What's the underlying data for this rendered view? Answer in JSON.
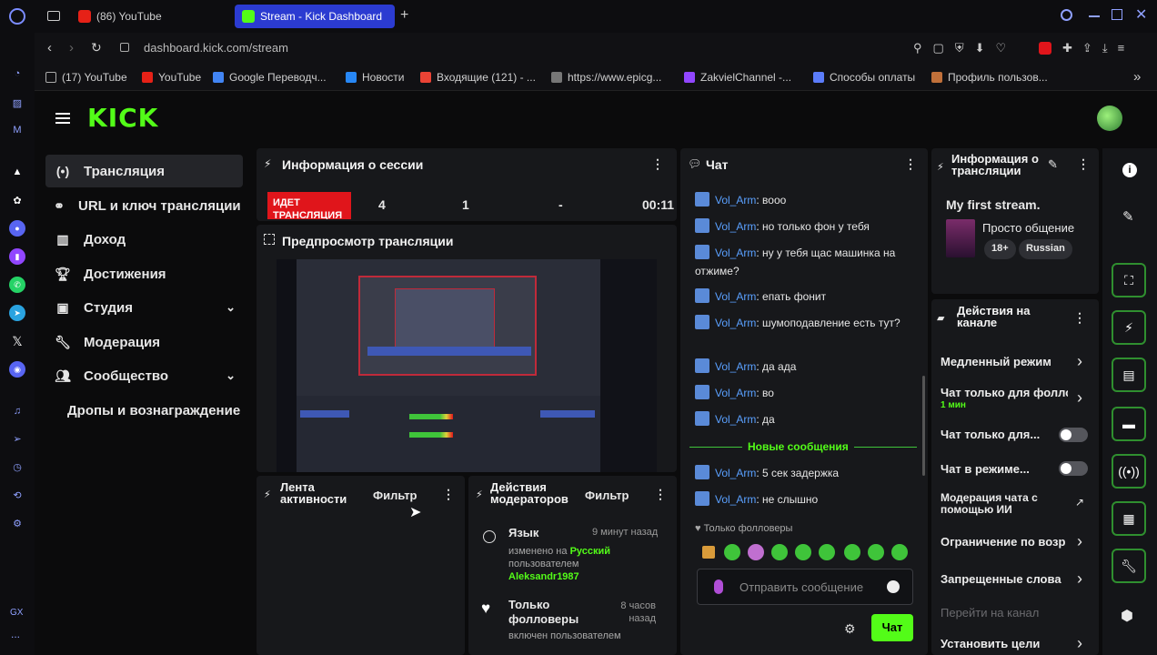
{
  "browser": {
    "tabs": [
      {
        "label": "(86) YouTube",
        "active": false
      },
      {
        "label": "Stream - Kick Dashboard",
        "active": true
      }
    ],
    "new_tab": "+",
    "url": "dashboard.kick.com/stream",
    "bookmarks": [
      "(17) YouTube",
      "YouTube",
      "Google Переводч...",
      "Новости",
      "Входящие (121) - ...",
      "https://www.epicg...",
      "ZakvielChannel -...",
      "Способы оплаты",
      "Профиль пользов..."
    ],
    "rail_footer": "GX",
    "rail_more": "..."
  },
  "app": {
    "logo": "KICK",
    "nav": [
      {
        "label": "Трансляция",
        "icon": "broadcast-icon",
        "active": true
      },
      {
        "label": "URL и ключ трансляции",
        "icon": "link-icon"
      },
      {
        "label": "Доход",
        "icon": "chart-icon"
      },
      {
        "label": "Достижения",
        "icon": "trophy-icon"
      },
      {
        "label": "Студия",
        "icon": "studio-icon",
        "expandable": true
      },
      {
        "label": "Модерация",
        "icon": "wrench-icon"
      },
      {
        "label": "Сообщество",
        "icon": "people-icon",
        "expandable": true
      },
      {
        "label": "Дропы и вознаграждение",
        "icon": "",
        "indent": true
      }
    ]
  },
  "session": {
    "title": "Информация о сессии",
    "status_badge": "ИДЕТ ТРАНСЛЯЦИЯ",
    "stats": [
      "4",
      "1",
      "-",
      "00:11"
    ]
  },
  "preview": {
    "title": "Предпросмотр трансляции"
  },
  "activity": {
    "title": "Лента активности",
    "filter": "Фильтр"
  },
  "mod_actions": {
    "title": "Действия модераторов",
    "filter": "Фильтр",
    "items": [
      {
        "title": "Язык",
        "time": "9 минут назад",
        "line1_prefix": "изменено на ",
        "line1_value": "Русский",
        "line2": "пользователем",
        "user": "Aleksandr1987"
      },
      {
        "title": "Только фолловеры",
        "time": "8 часов назад",
        "line1_prefix": "",
        "line1_value": "",
        "line2": "включен пользователем",
        "user": ""
      }
    ]
  },
  "chat": {
    "title": "Чат",
    "messages": [
      {
        "user": "Vol_Arm",
        "text": ": вооо"
      },
      {
        "user": "Vol_Arm",
        "text": ": но только фон у тебя"
      },
      {
        "user": "Vol_Arm",
        "text": ": ну у тебя щас машинка на отжиме?"
      },
      {
        "user": "Vol_Arm",
        "text": ": епать фонит"
      },
      {
        "user": "Vol_Arm",
        "text": ": шумоподавление есть тут?"
      },
      {
        "user": "Vol_Arm",
        "text": ": да ада"
      },
      {
        "user": "Vol_Arm",
        "text": ": во"
      },
      {
        "user": "Vol_Arm",
        "text": ": да"
      }
    ],
    "new_messages_label": "Новые сообщения",
    "new_messages": [
      {
        "user": "Vol_Arm",
        "text": ": 5 сек задержка"
      },
      {
        "user": "Vol_Arm",
        "text": ": не слышно"
      }
    ],
    "followers_only": "Только фолловеры",
    "input_placeholder": "Отправить сообщение",
    "send_button": "Чат"
  },
  "stream_info": {
    "title": "Информация о трансляции",
    "stream_title": "My first stream.",
    "category": "Просто общение",
    "tags": [
      "18+",
      "Russian"
    ]
  },
  "channel_actions": {
    "title": "Действия на канале",
    "items": [
      {
        "label": "Медленный режим",
        "control": "chevron"
      },
      {
        "label": "Чат только для фолло",
        "sub": "1 мин",
        "control": "chevron"
      },
      {
        "label": "Чат только для...",
        "control": "toggle"
      },
      {
        "label": "Чат в режиме...",
        "control": "toggle"
      },
      {
        "label": "Модерация чата с помощью ИИ",
        "control": "external"
      },
      {
        "label": "Ограничение по возр",
        "control": "chevron"
      },
      {
        "label": "Запрещенные слова",
        "control": "chevron"
      },
      {
        "label": "Перейти на канал",
        "control": "none",
        "muted": true
      },
      {
        "label": "Установить цели",
        "control": "chevron"
      }
    ]
  },
  "colors": {
    "accent": "#53fc18",
    "user": "#5aa0ff",
    "live_badge": "#e0151b",
    "tab_active": "#2b3bd1"
  }
}
